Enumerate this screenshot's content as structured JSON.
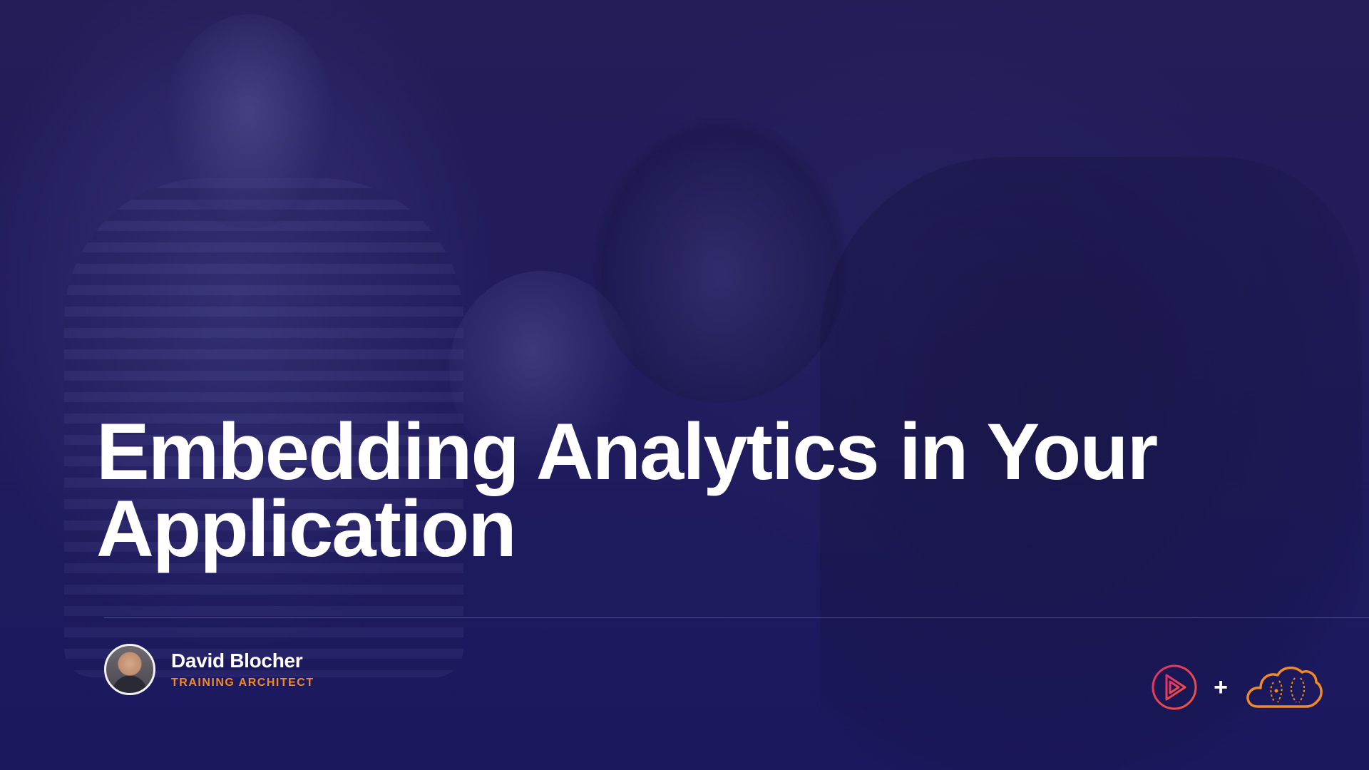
{
  "slide": {
    "title_line1": "Embedding Analytics in Your",
    "title_line2": "Application",
    "presenter": {
      "name": "David Blocher",
      "role": "TRAINING ARCHITECT"
    },
    "brand": {
      "left_logo": "pluralsight-play-icon",
      "separator": "+",
      "right_logo": "a-cloud-guru-icon"
    }
  },
  "colors": {
    "background": "#221c5c",
    "title": "#ffffff",
    "role_accent": "#f28a2a",
    "play_logo_pink": "#e0306a",
    "play_logo_red": "#f0573a",
    "cloud_logo_orange": "#f08a24"
  }
}
